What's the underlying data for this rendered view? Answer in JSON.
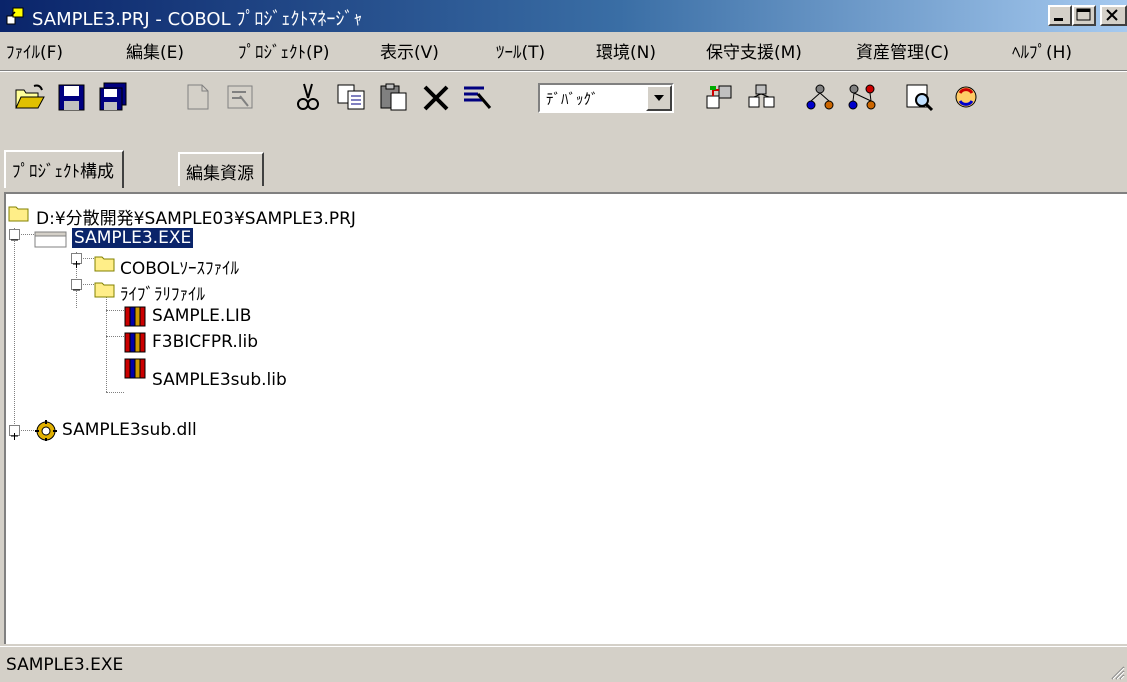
{
  "window": {
    "title": "SAMPLE3.PRJ - COBOL ﾌﾟﾛｼﾞｪｸﾄﾏﾈｰｼﾞｬ"
  },
  "menu": [
    {
      "label": "ﾌｧｲﾙ(F)"
    },
    {
      "label": "編集(E)"
    },
    {
      "label": "ﾌﾟﾛｼﾞｪｸﾄ(P)"
    },
    {
      "label": "表示(V)"
    },
    {
      "label": "ﾂｰﾙ(T)"
    },
    {
      "label": "環境(N)"
    },
    {
      "label": "保守支援(M)"
    },
    {
      "label": "資産管理(C)"
    },
    {
      "label": "ﾍﾙﾌﾟ(H)"
    }
  ],
  "toolbar": {
    "buttons": [
      {
        "icon": "open-folder-icon"
      },
      {
        "icon": "save-icon"
      },
      {
        "icon": "save-all-icon"
      },
      {
        "icon": "new-document-icon"
      },
      {
        "icon": "properties-icon"
      },
      {
        "icon": "cut-icon"
      },
      {
        "icon": "copy-icon"
      },
      {
        "icon": "paste-icon"
      },
      {
        "icon": "delete-icon"
      },
      {
        "icon": "build-options-icon"
      },
      {
        "icon": "build-icon"
      },
      {
        "icon": "rebuild-icon"
      },
      {
        "icon": "link-icon"
      },
      {
        "icon": "relink-icon"
      },
      {
        "icon": "search-icon"
      },
      {
        "icon": "refresh-icon"
      }
    ],
    "mode_select": {
      "value": "ﾃﾞﾊﾞｯｸﾞ"
    }
  },
  "tabs": [
    {
      "label": "ﾌﾟﾛｼﾞｪｸﾄ構成",
      "active": true
    },
    {
      "label": "編集資源",
      "active": false
    }
  ],
  "tree": {
    "root": "D:¥分散開発¥SAMPLE03¥SAMPLE3.PRJ",
    "exe": "SAMPLE3.EXE",
    "cobol_folder": "COBOLｿｰｽﾌｧｲﾙ",
    "library_folder": "ﾗｲﾌﾞﾗﾘﾌｧｲﾙ",
    "libraries": [
      "SAMPLE.LIB",
      "F3BICFPR.lib",
      "SAMPLE3sub.lib"
    ],
    "dll": "SAMPLE3sub.dll"
  },
  "status": {
    "text": "SAMPLE3.EXE"
  },
  "colors": {
    "titlebar_start": "#0a246a",
    "titlebar_end": "#a6caf0",
    "selection": "#0a246a",
    "face": "#d4d0c8"
  }
}
